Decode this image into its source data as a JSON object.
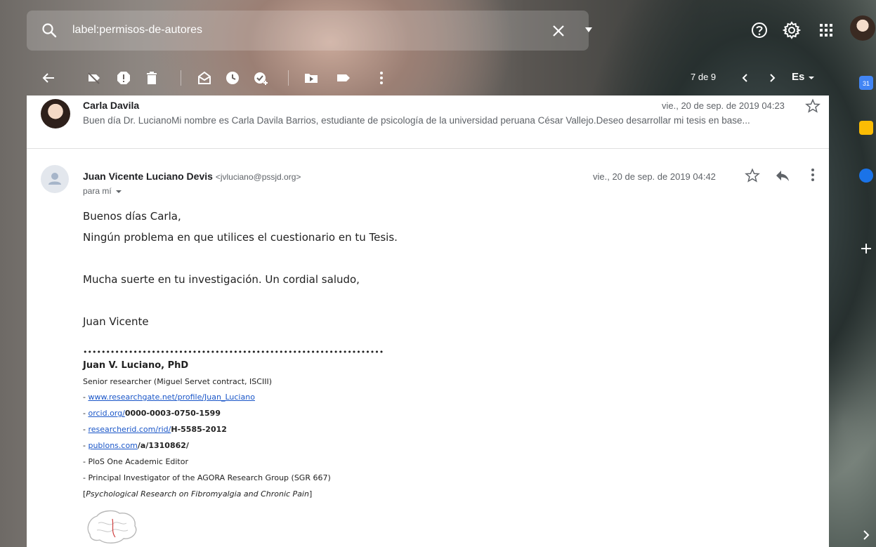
{
  "search": {
    "query": "label:permisos-de-autores"
  },
  "toolbar": {
    "pager": "7 de 9",
    "lang": "Es"
  },
  "thread": {
    "prev_message": {
      "sender": "Carla Davila",
      "date": "vie., 20 de sep. de 2019 04:23",
      "snippet": "Buen día Dr. LucianoMi nombre es Carla Davila Barrios, estudiante de psicología de la universidad peruana César Vallejo.Deseo desarrollar mi tesis en base..."
    },
    "message": {
      "sender_name": "Juan Vicente Luciano Devis",
      "sender_email": "<jvluciano@pssjd.org>",
      "to": "para mí",
      "date": "vie., 20 de sep. de 2019 04:42",
      "body": [
        "Buenos días Carla,",
        "Ningún problema en que utilices el cuestionario en tu Tesis.",
        "Mucha suerte en tu investigación. Un cordial saludo,",
        "Juan Vicente"
      ],
      "signature": {
        "dots": "••••••••••••••••••••••••••••••••••••••••••••••••••••••••••••••••••",
        "name": "Juan V. Luciano, PhD",
        "role": "Senior researcher (Miguel Servet contract, ISCIII)",
        "rg_prefix": "- ",
        "rg_link": "www.researchgate.net/profile/Juan_Luciano",
        "orcid_prefix": "- ",
        "orcid_link": "orcid.org/",
        "orcid_id": "0000-0003-0750-1599",
        "rid_prefix": "- ",
        "rid_link": "researcherid.com/rid/",
        "rid_id": "H-5585-2012",
        "publons_prefix": "- ",
        "publons_link": "publons.com",
        "publons_id": "/a/1310862/",
        "plos": "- PloS One Academic Editor",
        "pi": "- Principal Investigator of the AGORA Research Group (SGR 667)",
        "research_open": "[",
        "research": "Psychological Research on Fibromyalgia and Chronic Pain",
        "research_close": "]"
      }
    }
  },
  "rail": {
    "calendar_day": "31"
  },
  "colors": {
    "link": "#1a56c8",
    "calendar": "#4285f4",
    "keep": "#fbbc04",
    "tasks": "#1a73e8"
  }
}
